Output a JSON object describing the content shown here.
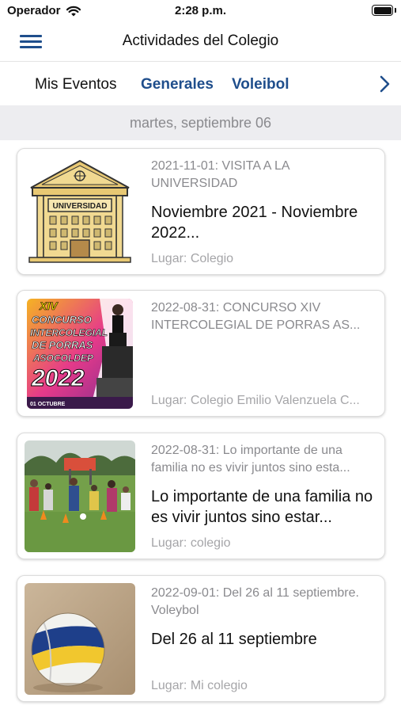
{
  "status_bar": {
    "carrier": "Operador",
    "time": "2:28 p.m."
  },
  "nav": {
    "title": "Actividades del Colegio"
  },
  "tabs": [
    {
      "label": "Mis Eventos",
      "selected": true
    },
    {
      "label": "Generales",
      "selected": false
    },
    {
      "label": "Voleibol",
      "selected": false
    }
  ],
  "date_header": "martes, septiembre 06",
  "events": [
    {
      "subtitle": "2021-11-01: VISITA A LA UNIVERSIDAD",
      "title": "Noviembre 2021 - Noviembre 2022...",
      "place": "Lugar: Colegio",
      "image_text": "UNIVERSIDAD",
      "image": "university-building-illustration"
    },
    {
      "subtitle": "2022-08-31: CONCURSO XIV INTERCOLEGIAL DE PORRAS AS...",
      "title": "",
      "place": "Lugar: Colegio Emilio Valenzuela C...",
      "image": "cheerleading-poster",
      "image_text": [
        "XIV",
        "CONCURSO",
        "INTERCOLEGIAL",
        "DE PORRAS",
        "ASOCOLDEP",
        "2022",
        "01 OCTUBRE"
      ]
    },
    {
      "subtitle": "2022-08-31: Lo importante de una familia no es vivir juntos sino esta...",
      "title": "Lo importante de una familia no es vivir juntos sino estar...",
      "place": "Lugar:  colegio",
      "image": "family-outdoor-photo"
    },
    {
      "subtitle": "2022-09-01: Del 26 al 11 septiembre. Voleybol",
      "title": "Del 26 al 11 septiembre",
      "place": "Lugar: Mi colegio",
      "image": "volleyball-on-sand-photo"
    }
  ],
  "colors": {
    "accent": "#1f4e8c",
    "date_header_bg": "#ededf0",
    "secondary_text": "#8a8a8e"
  }
}
